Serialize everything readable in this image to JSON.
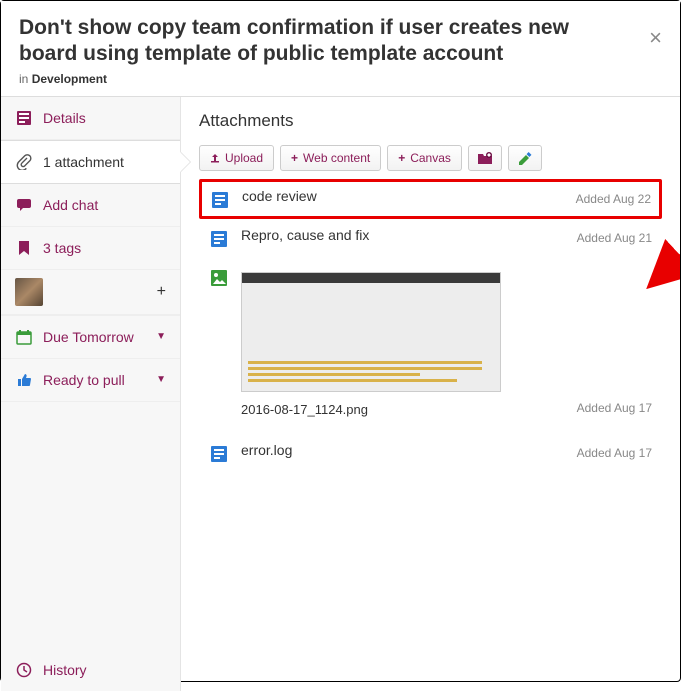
{
  "header": {
    "title": "Don't show copy team confirmation if user creates new board using template of public template account",
    "breadcrumb_prefix": "in ",
    "breadcrumb_location": "Development"
  },
  "sidebar": {
    "details": "Details",
    "attachments": "1 attachment",
    "chat": "Add chat",
    "tags": "3 tags",
    "due": "Due Tomorrow",
    "status": "Ready to pull",
    "history": "History"
  },
  "main": {
    "heading": "Attachments",
    "toolbar": {
      "upload": "Upload",
      "web": "Web content",
      "canvas": "Canvas"
    },
    "items": [
      {
        "name": "code review",
        "date": "Added Aug 22"
      },
      {
        "name": "Repro, cause and fix",
        "date": "Added Aug 21"
      },
      {
        "name": "2016-08-17_1124.png",
        "date": "Added Aug 17"
      },
      {
        "name": "error.log",
        "date": "Added Aug 17"
      }
    ]
  }
}
